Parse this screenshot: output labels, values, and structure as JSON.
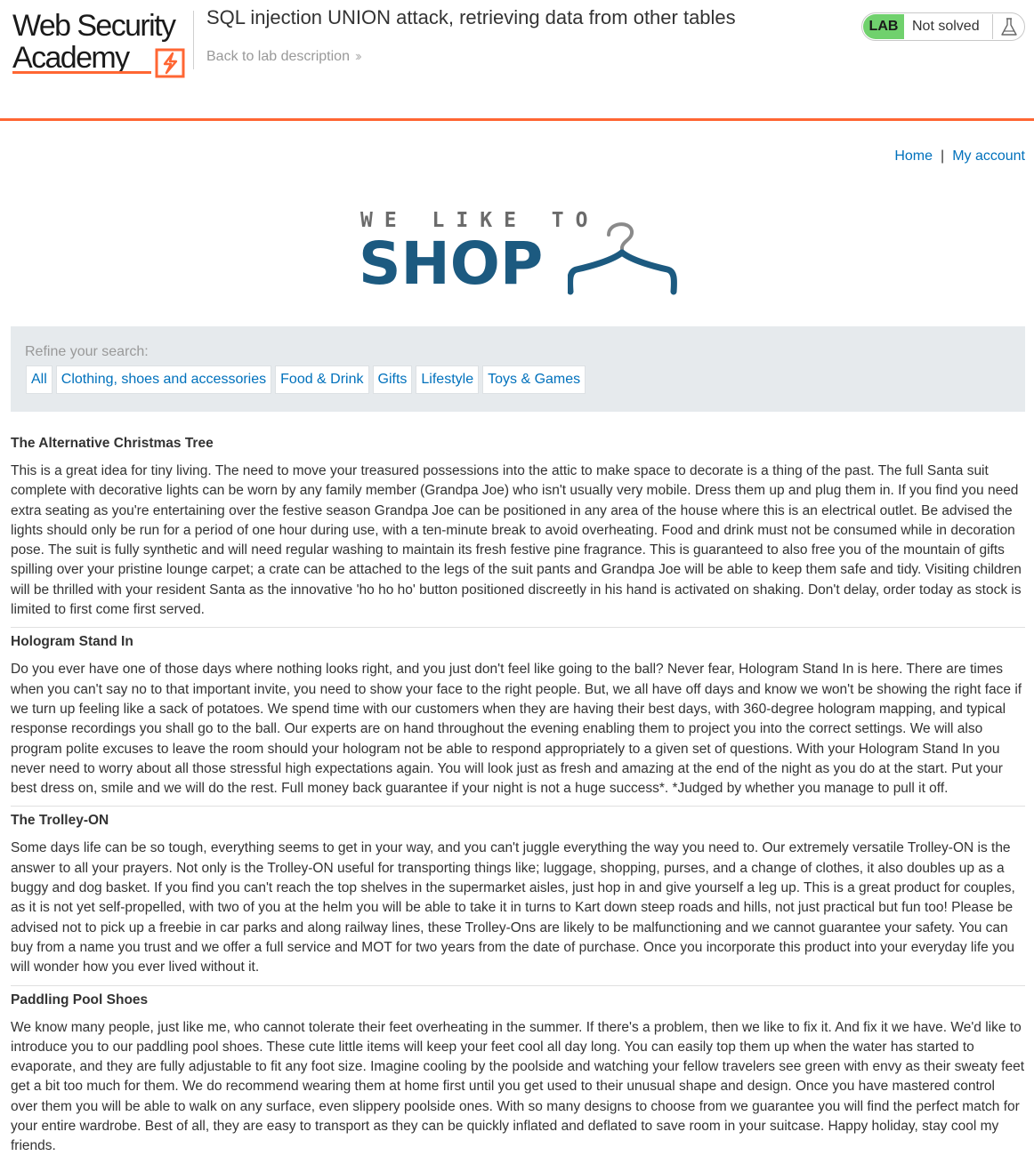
{
  "academy": {
    "logo_line1": "Web Security",
    "logo_line2": "Academy",
    "lab_title": "SQL injection UNION attack, retrieving data from other tables",
    "back_link": "Back to lab description",
    "status_badge": "LAB",
    "status_text": "Not solved",
    "accent_color": "#ff6633",
    "status_color": "#70d16d"
  },
  "nav": {
    "home": "Home",
    "separator": "|",
    "my_account": "My account"
  },
  "shop_logo": {
    "tagline": "WE LIKE TO",
    "word": "SHOP",
    "icon": "hanger-icon",
    "color": "#1c5a80"
  },
  "filter": {
    "label": "Refine your search:",
    "categories": [
      "All",
      "Clothing, shoes and accessories",
      "Food & Drink",
      "Gifts",
      "Lifestyle",
      "Toys & Games"
    ]
  },
  "products": [
    {
      "name": "The Alternative Christmas Tree",
      "description": "This is a great idea for tiny living. The need to move your treasured possessions into the attic to make space to decorate is a thing of the past. The full Santa suit complete with decorative lights can be worn by any family member (Grandpa Joe) who isn't usually very mobile. Dress them up and plug them in. If you find you need extra seating as you're entertaining over the festive season Grandpa Joe can be positioned in any area of the house where this is an electrical outlet. Be advised the lights should only be run for a period of one hour during use, with a ten-minute break to avoid overheating. Food and drink must not be consumed while in decoration pose. The suit is fully synthetic and will need regular washing to maintain its fresh festive pine fragrance. This is guaranteed to also free you of the mountain of gifts spilling over your pristine lounge carpet; a crate can be attached to the legs of the suit pants and Grandpa Joe will be able to keep them safe and tidy. Visiting children will be thrilled with your resident Santa as the innovative 'ho ho ho' button positioned discreetly in his hand is activated on shaking. Don't delay, order today as stock is limited to first come first served."
    },
    {
      "name": "Hologram Stand In",
      "description": "Do you ever have one of those days where nothing looks right, and you just don't feel like going to the ball? Never fear, Hologram Stand In is here. There are times when you can't say no to that important invite, you need to show your face to the right people. But, we all have off days and know we won't be showing the right face if we turn up feeling like a sack of potatoes. We spend time with our customers when they are having their best days, with 360-degree hologram mapping, and typical response recordings you shall go to the ball. Our experts are on hand throughout the evening enabling them to project you into the correct settings. We will also program polite excuses to leave the room should your hologram not be able to respond appropriately to a given set of questions. With your Hologram Stand In you never need to worry about all those stressful high expectations again. You will look just as fresh and amazing at the end of the night as you do at the start. Put your best dress on, smile and we will do the rest. Full money back guarantee if your night is not a huge success*. *Judged by whether you manage to pull it off."
    },
    {
      "name": "The Trolley-ON",
      "description": "Some days life can be so tough, everything seems to get in your way, and you can't juggle everything the way you need to. Our extremely versatile Trolley-ON is the answer to all your prayers. Not only is the Trolley-ON useful for transporting things like; luggage, shopping, purses, and a change of clothes, it also doubles up as a buggy and dog basket. If you find you can't reach the top shelves in the supermarket aisles, just hop in and give yourself a leg up. This is a great product for couples, as it is not yet self-propelled, with two of you at the helm you will be able to take it in turns to Kart down steep roads and hills, not just practical but fun too! Please be advised not to pick up a freebie in car parks and along railway lines, these Trolley-Ons are likely to be malfunctioning and we cannot guarantee your safety. You can buy from a name you trust and we offer a full service and MOT for two years from the date of purchase. Once you incorporate this product into your everyday life you will wonder how you ever lived without it."
    },
    {
      "name": "Paddling Pool Shoes",
      "description": "We know many people, just like me, who cannot tolerate their feet overheating in the summer. If there's a problem, then we like to fix it. And fix it we have. We'd like to introduce you to our paddling pool shoes. These cute little items will keep your feet cool all day long. You can easily top them up when the water has started to evaporate, and they are fully adjustable to fit any foot size. Imagine cooling by the poolside and watching your fellow travelers see green with envy as their sweaty feet get a bit too much for them. We do recommend wearing them at home first until you get used to their unusual shape and design. Once you have mastered control over them you will be able to walk on any surface, even slippery poolside ones. With so many designs to choose from we guarantee you will find the perfect match for your entire wardrobe. Best of all, they are easy to transport as they can be quickly inflated and deflated to save room in your suitcase. Happy holiday, stay cool my friends."
    }
  ]
}
